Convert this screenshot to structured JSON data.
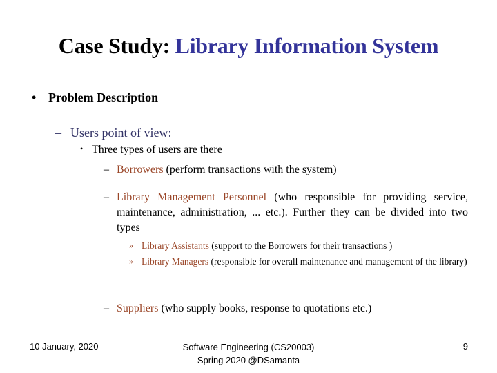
{
  "slide": {
    "title_part1": "Case Study:",
    "title_part2": "Library Information System",
    "colors": {
      "title_accent": "#333399",
      "highlight": "#9a4628",
      "subheading": "#333366"
    },
    "level1": {
      "bullet": "•",
      "text": "Problem Description"
    },
    "level2": {
      "dash": "–",
      "text": "Users point of view:"
    },
    "level3": {
      "bullet": "•",
      "text": "Three types of users are there"
    },
    "user_types": [
      {
        "dash": "–",
        "name": "Borrowers",
        "desc": " (perform transactions with the system)"
      },
      {
        "dash": "–",
        "name": "Library Management Personnel",
        "desc": " (who responsible for providing service, maintenance, administration, ... etc.). Further they can be divided into  two types"
      },
      {
        "dash": "–",
        "name": "Suppliers",
        "desc": " (who supply books, response to quotations etc.)"
      }
    ],
    "personnel_types": [
      {
        "mark": "»",
        "name": "Library Assistants",
        "desc": " (support to the Borrowers for their transactions )"
      },
      {
        "mark": "»",
        "name": "Library Managers",
        "desc": " (responsible for overall maintenance and management of the library)"
      }
    ]
  },
  "footer": {
    "date": "10 January, 2020",
    "course_line1": "Software Engineering (CS20003)",
    "course_line2": "Spring 2020 @DSamanta",
    "page_number": "9"
  }
}
